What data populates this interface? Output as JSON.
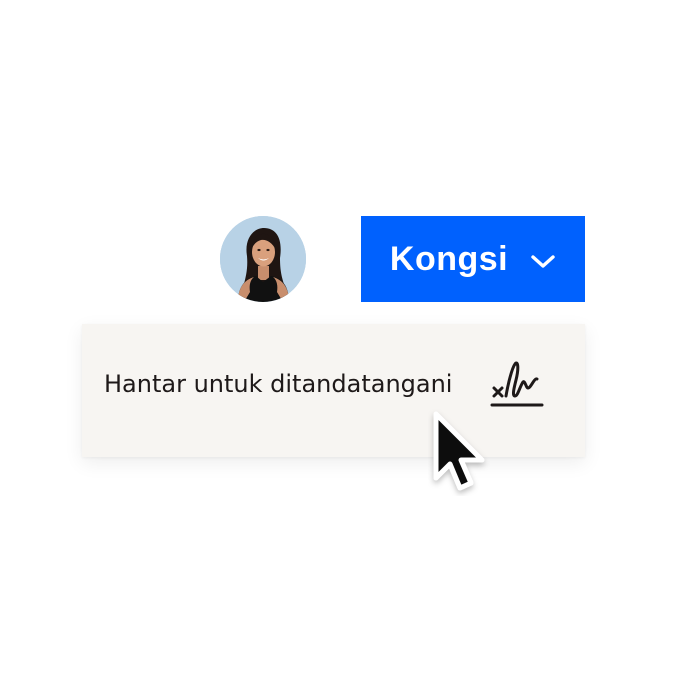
{
  "share_button": {
    "label": "Kongsi",
    "icon": "chevron-down-icon",
    "color": "#0061fe",
    "text_color": "#ffffff"
  },
  "avatar": {
    "icon": "user-avatar-photo"
  },
  "menu": {
    "items": [
      {
        "label": "Hantar untuk ditandatangani",
        "icon": "signature-icon"
      }
    ],
    "background": "#f7f5f2"
  },
  "cursor": {
    "icon": "mouse-pointer-icon"
  }
}
